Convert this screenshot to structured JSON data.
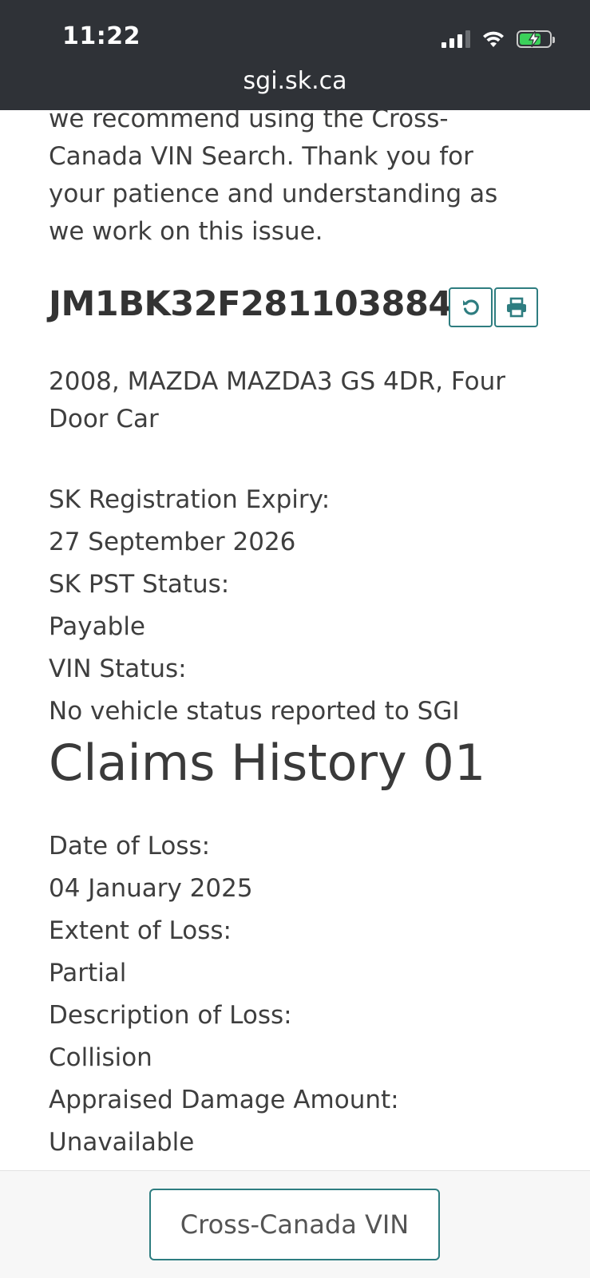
{
  "status_bar": {
    "time": "11:22"
  },
  "browser": {
    "url": "sgi.sk.ca"
  },
  "notice": {
    "line1": "we recommend using the Cross-",
    "line2": "Canada VIN Search. Thank you for",
    "line3": "your patience and understanding as",
    "line4": "we work on this issue."
  },
  "vehicle": {
    "vin": "JM1BK32F281103884",
    "description": "2008, MAZDA MAZDA3 GS 4DR, Four Door Car",
    "registration_label": "SK Registration Expiry:",
    "registration_value": "27 September 2026",
    "pst_label": "SK PST Status:",
    "pst_value": "Payable",
    "vin_status_label": "VIN Status:",
    "vin_status_value": "No vehicle status reported to SGI"
  },
  "claims": {
    "title": "Claims History 01",
    "date_label": "Date of Loss:",
    "date_value": "04 January 2025",
    "extent_label": "Extent of Loss:",
    "extent_value": "Partial",
    "description_label": "Description of Loss:",
    "description_value": "Collision",
    "damage_label": "Appraised Damage Amount:",
    "damage_value": "Unavailable"
  },
  "actions": {
    "cross_canada_label": "Cross-Canada VIN"
  },
  "icons": {
    "refresh": "refresh-icon",
    "print": "print-icon"
  },
  "colors": {
    "accent": "#2e7d80",
    "topbar": "#2f3237",
    "battery": "#3bd05a"
  }
}
